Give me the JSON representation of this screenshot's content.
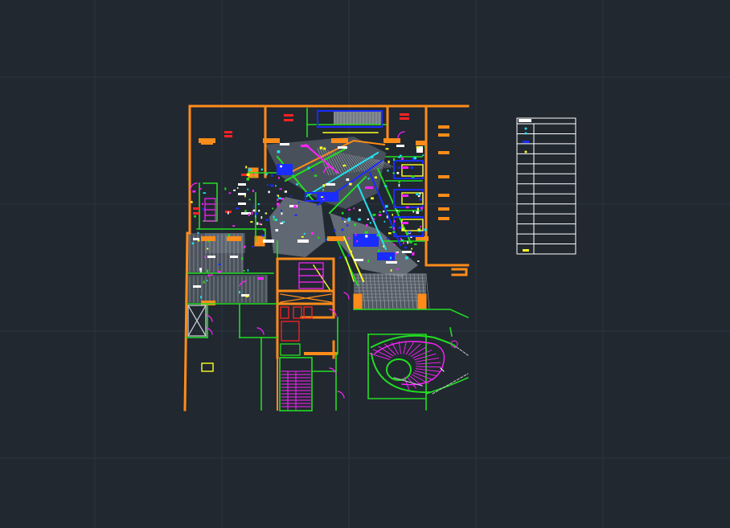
{
  "viewport": {
    "background": "#212830",
    "grid_color": "#2c3642",
    "layer_colors": {
      "wall": "#ff8c1a",
      "green": "#22dd22",
      "magenta": "#ff22ff",
      "cyan": "#22e0f0",
      "blue": "#1a2cff",
      "yellow": "#ffff22",
      "red": "#ff2222",
      "white": "#ffffff",
      "gray": "#8a93a0"
    }
  },
  "legend_table": {
    "rows": 12
  }
}
